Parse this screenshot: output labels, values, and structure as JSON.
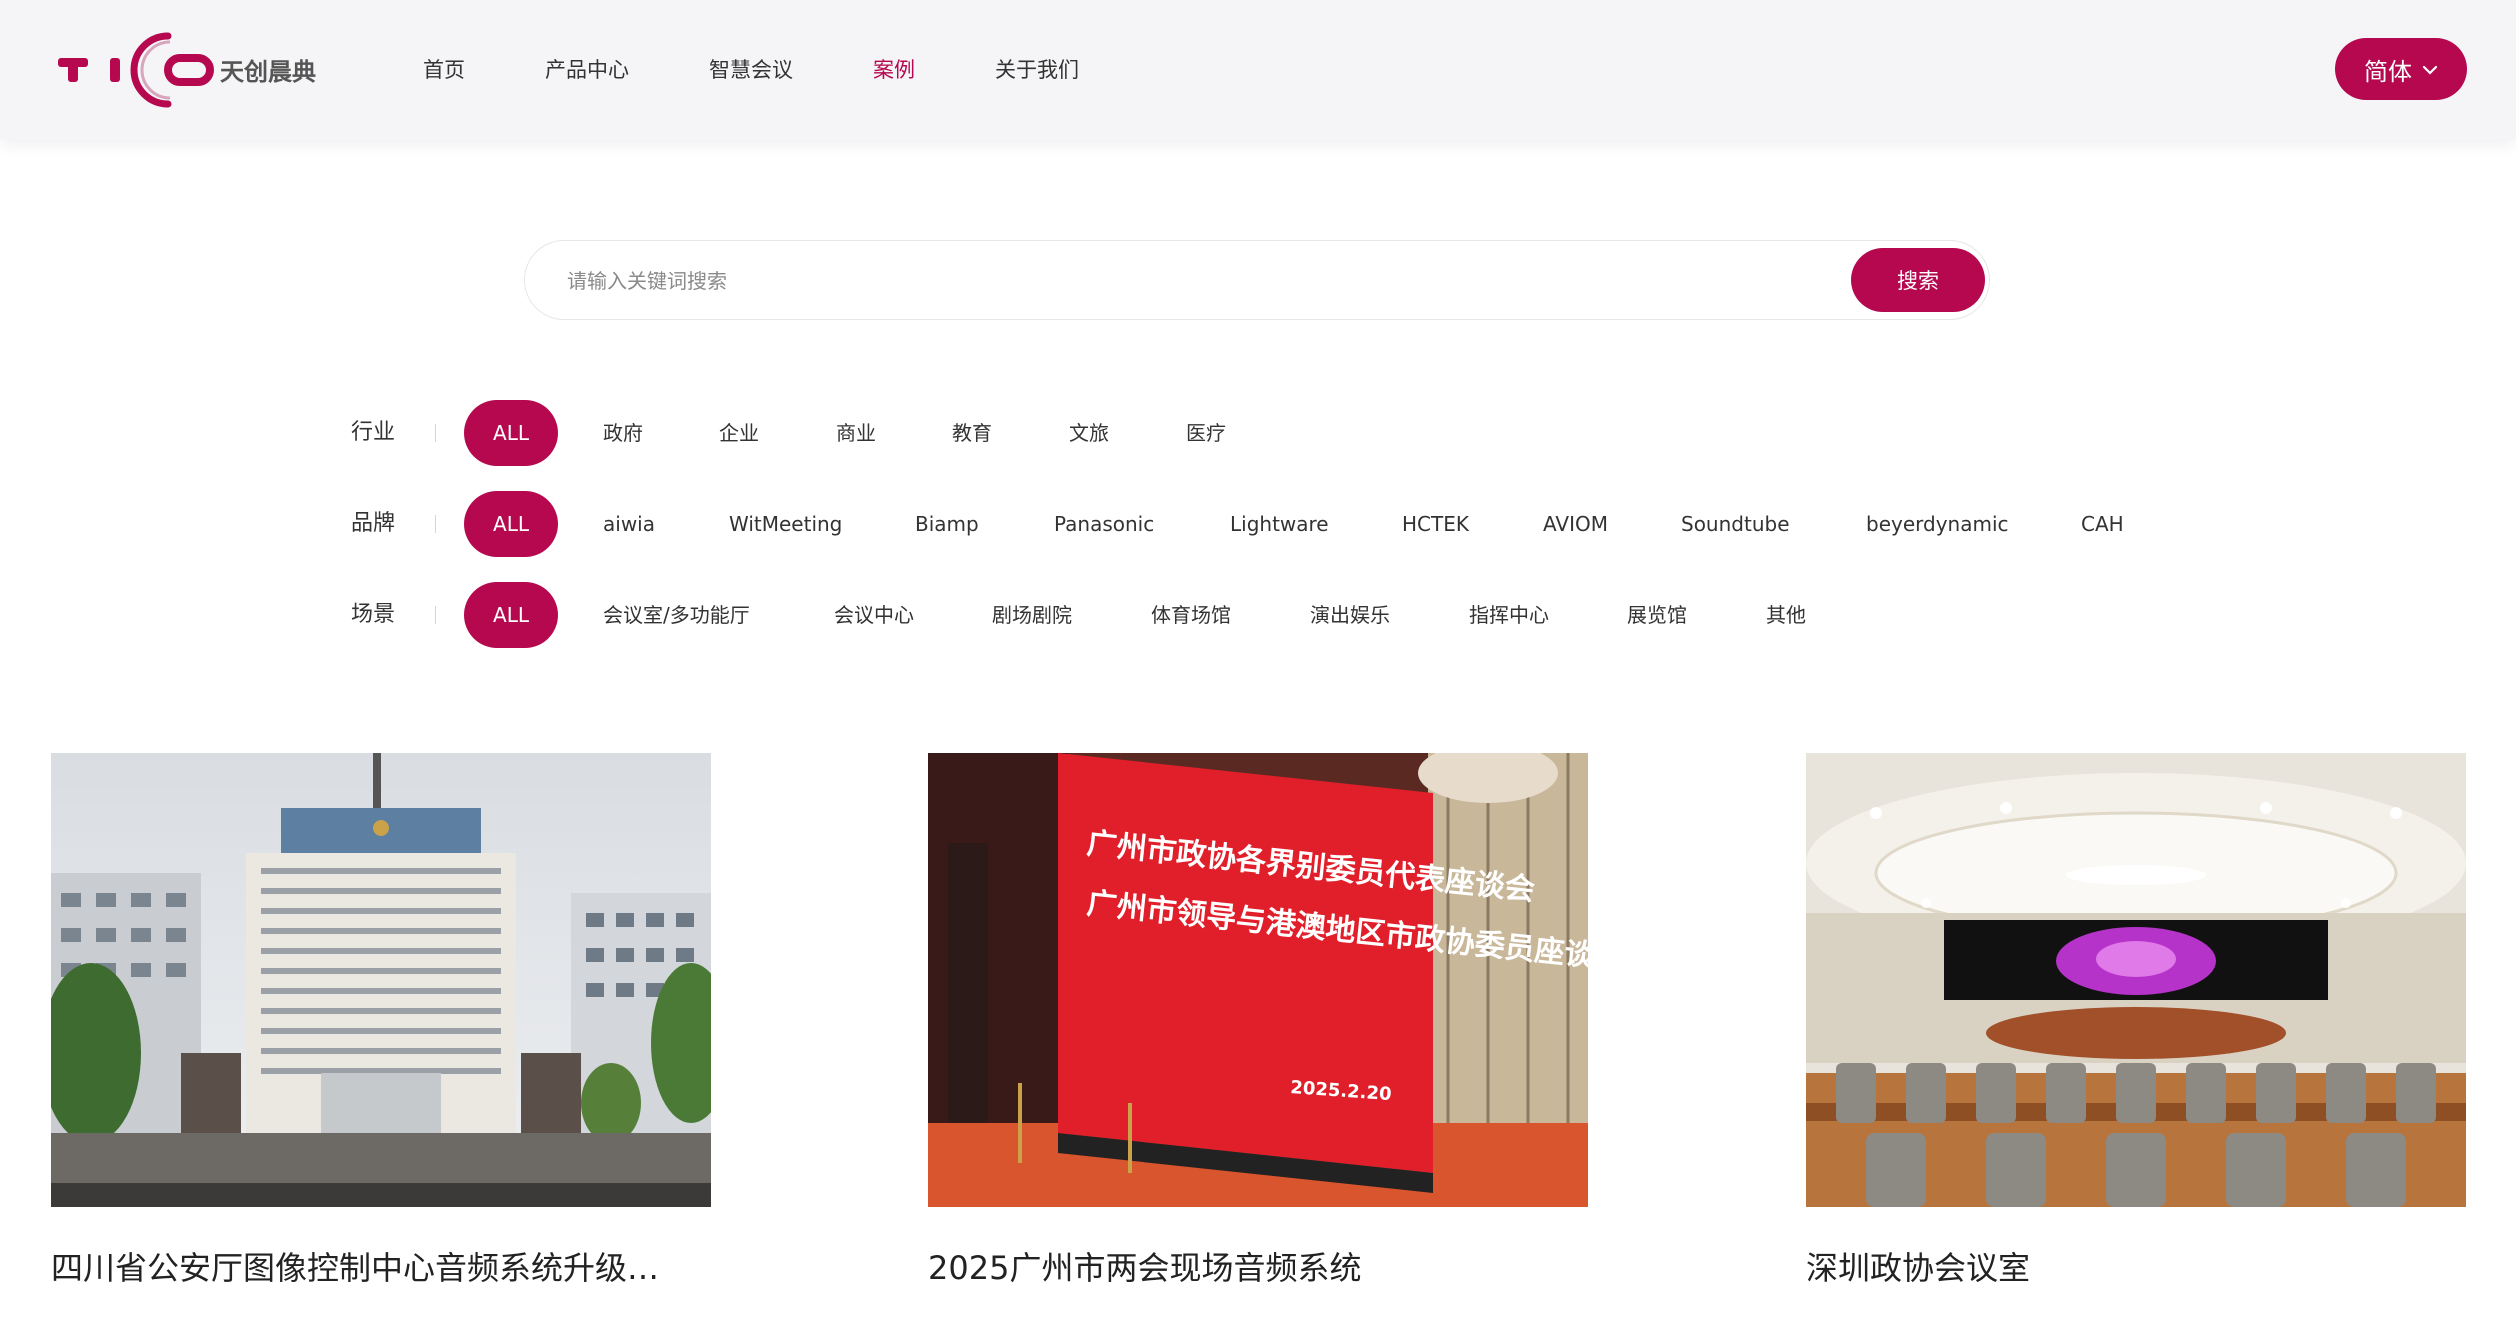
{
  "brand": {
    "logo_text": "TICO",
    "logo_cn": "天创晨典",
    "accent": "#b5084f"
  },
  "nav": {
    "items": [
      {
        "label": "首页"
      },
      {
        "label": "产品中心"
      },
      {
        "label": "智慧会议"
      },
      {
        "label": "案例",
        "active": true
      },
      {
        "label": "关于我们"
      }
    ],
    "lang": {
      "label": "简体",
      "icon": "chevron-down-icon"
    }
  },
  "search": {
    "placeholder": "请输入关键词搜索",
    "value": "",
    "button": "搜索"
  },
  "filters": {
    "industry": {
      "label": "行业",
      "options": [
        "ALL",
        "政府",
        "企业",
        "商业",
        "教育",
        "文旅",
        "医疗"
      ],
      "selected": "ALL"
    },
    "brand": {
      "label": "品牌",
      "options": [
        "ALL",
        "aiwia",
        "WitMeeting",
        "Biamp",
        "Panasonic",
        "Lightware",
        "HCTEK",
        "AVIOM",
        "Soundtube",
        "beyerdynamic",
        "CAH"
      ],
      "selected": "ALL"
    },
    "scene": {
      "label": "场景",
      "options": [
        "ALL",
        "会议室/多功能厅",
        "会议中心",
        "剧场剧院",
        "体育场馆",
        "演出娱乐",
        "指挥中心",
        "展览馆",
        "其他"
      ],
      "selected": "ALL"
    }
  },
  "cases": [
    {
      "title": "四川省公安厅图像控制中心音频系统升级…",
      "image": "government-building-photo"
    },
    {
      "title": "2025广州市两会现场音频系统",
      "image": "red-led-wall-photo",
      "screen_lines": [
        "广州市政协各界别委员代表座谈会",
        "广州市领导与港澳地区市政协委员座谈会"
      ],
      "screen_date": "2025.2.20"
    },
    {
      "title": "深圳政协会议室",
      "image": "round-conference-room-photo"
    }
  ]
}
